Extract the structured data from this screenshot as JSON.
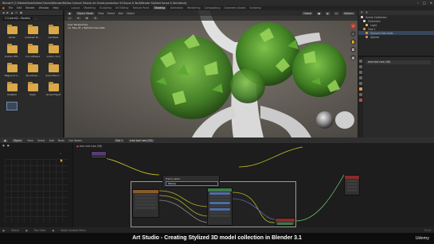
{
  "window": {
    "title": "Blender* [C:\\Media\\Model\\Video\\Tutorial\\Blender\\Nikitas Grahom Tutorial Art Studio production 04 House & Yard\\Blender Stylized House & Yard.blend]",
    "controls": [
      "–",
      "□",
      "✕"
    ]
  },
  "menubar": {
    "items": [
      "File",
      "Edit",
      "Render",
      "Window",
      "Help"
    ],
    "workspaces": [
      "Layout",
      "Modeling",
      "Sculpting",
      "UV Editing",
      "Texture Paint",
      "Shading",
      "Animation",
      "Rendering",
      "Compositing",
      "Geometry Nodes",
      "Scripting"
    ],
    "active": "Shading"
  },
  "file_browser": {
    "path": "C:\\Users\\D...Models\\",
    "items": [
      {
        "name": "Adobe",
        "icon": "folder-icon"
      },
      {
        "name": "Autodesk Sh...",
        "icon": "folder-icon"
      },
      {
        "name": "Camtasia",
        "icon": "folder-icon"
      },
      {
        "name": "Custom Offi...",
        "icon": "folder-icon"
      },
      {
        "name": "icon software",
        "icon": "folder-icon"
      },
      {
        "name": "Lumion 11.0",
        "icon": "folder-icon"
      },
      {
        "name": "Magpie sh e...",
        "icon": "folder-icon"
      },
      {
        "name": "My Games...",
        "icon": "folder-icon"
      },
      {
        "name": "Sound Recor...",
        "icon": "folder-icon"
      },
      {
        "name": "OneNote",
        "icon": "folder-icon"
      },
      {
        "name": "Poeta",
        "icon": "folder-icon"
      },
      {
        "name": "Unreal Project",
        "icon": "folder-icon"
      },
      {
        "name": "",
        "icon": "image-thumb-icon"
      }
    ]
  },
  "viewport": {
    "header": {
      "mode": "Object Mode",
      "menus": [
        "View",
        "Select",
        "Add",
        "Object"
      ],
      "shading": "Global"
    },
    "info_lines": [
      "User Perspective",
      "(1) Tree_01 | Stylized tree leafs"
    ],
    "options_label": "Options"
  },
  "outliner": {
    "title": "Scene Collection",
    "rows": [
      {
        "label": "Scene Collection",
        "selected": false
      },
      {
        "label": "Collection",
        "selected": false
      },
      {
        "label": "Light",
        "selected": false
      },
      {
        "label": "Tree 1",
        "selected": false
      },
      {
        "label": "Stylized tree leafs",
        "selected": true
      },
      {
        "label": "Sphere",
        "selected": false
      }
    ]
  },
  "properties": {
    "title": "tree leaf new (58)"
  },
  "node_editor": {
    "header_items": [
      "Object",
      "View",
      "Select",
      "Add",
      "Node",
      "Use Nodes",
      "Slot 1",
      "tree leaf new (58)"
    ],
    "breadcrumb": "tree leaf new (58)",
    "rename_popup": {
      "label": "Frame Label",
      "value": "Stamp"
    }
  },
  "status_bar": {
    "items": [
      "Select",
      "Pan View",
      "Node Context Menu"
    ],
    "version": "3.1.0"
  },
  "caption": {
    "text": "Art Studio - Creating Stylized 3D model collection in Blender 3.1",
    "brand": "Udemy"
  },
  "colors": {
    "accent": "#5680c2",
    "folder": "#d8a84a",
    "leaf_green": "#4f8f2a",
    "selection": "#36475c"
  }
}
